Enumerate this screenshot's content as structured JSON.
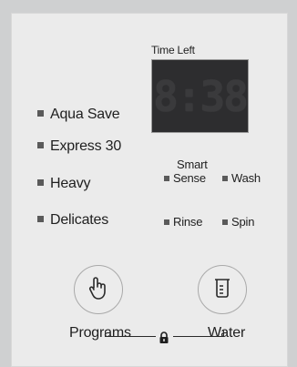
{
  "programs": {
    "items": [
      {
        "label": "Aqua Save"
      },
      {
        "label": "Express 30"
      },
      {
        "label": "Heavy"
      },
      {
        "label": "Delicates"
      }
    ]
  },
  "display": {
    "time_label": "Time Left",
    "time_value": "8:38"
  },
  "options": {
    "smart": "Smart",
    "sense": "Sense",
    "wash": "Wash",
    "rinse": "Rinse",
    "spin": "Spin"
  },
  "buttons": {
    "programs": {
      "label": "Programs",
      "icon": "touch-hand-icon"
    },
    "water": {
      "label": "Water",
      "icon": "water-beaker-icon"
    }
  },
  "lock": {
    "icon": "lock-icon"
  }
}
